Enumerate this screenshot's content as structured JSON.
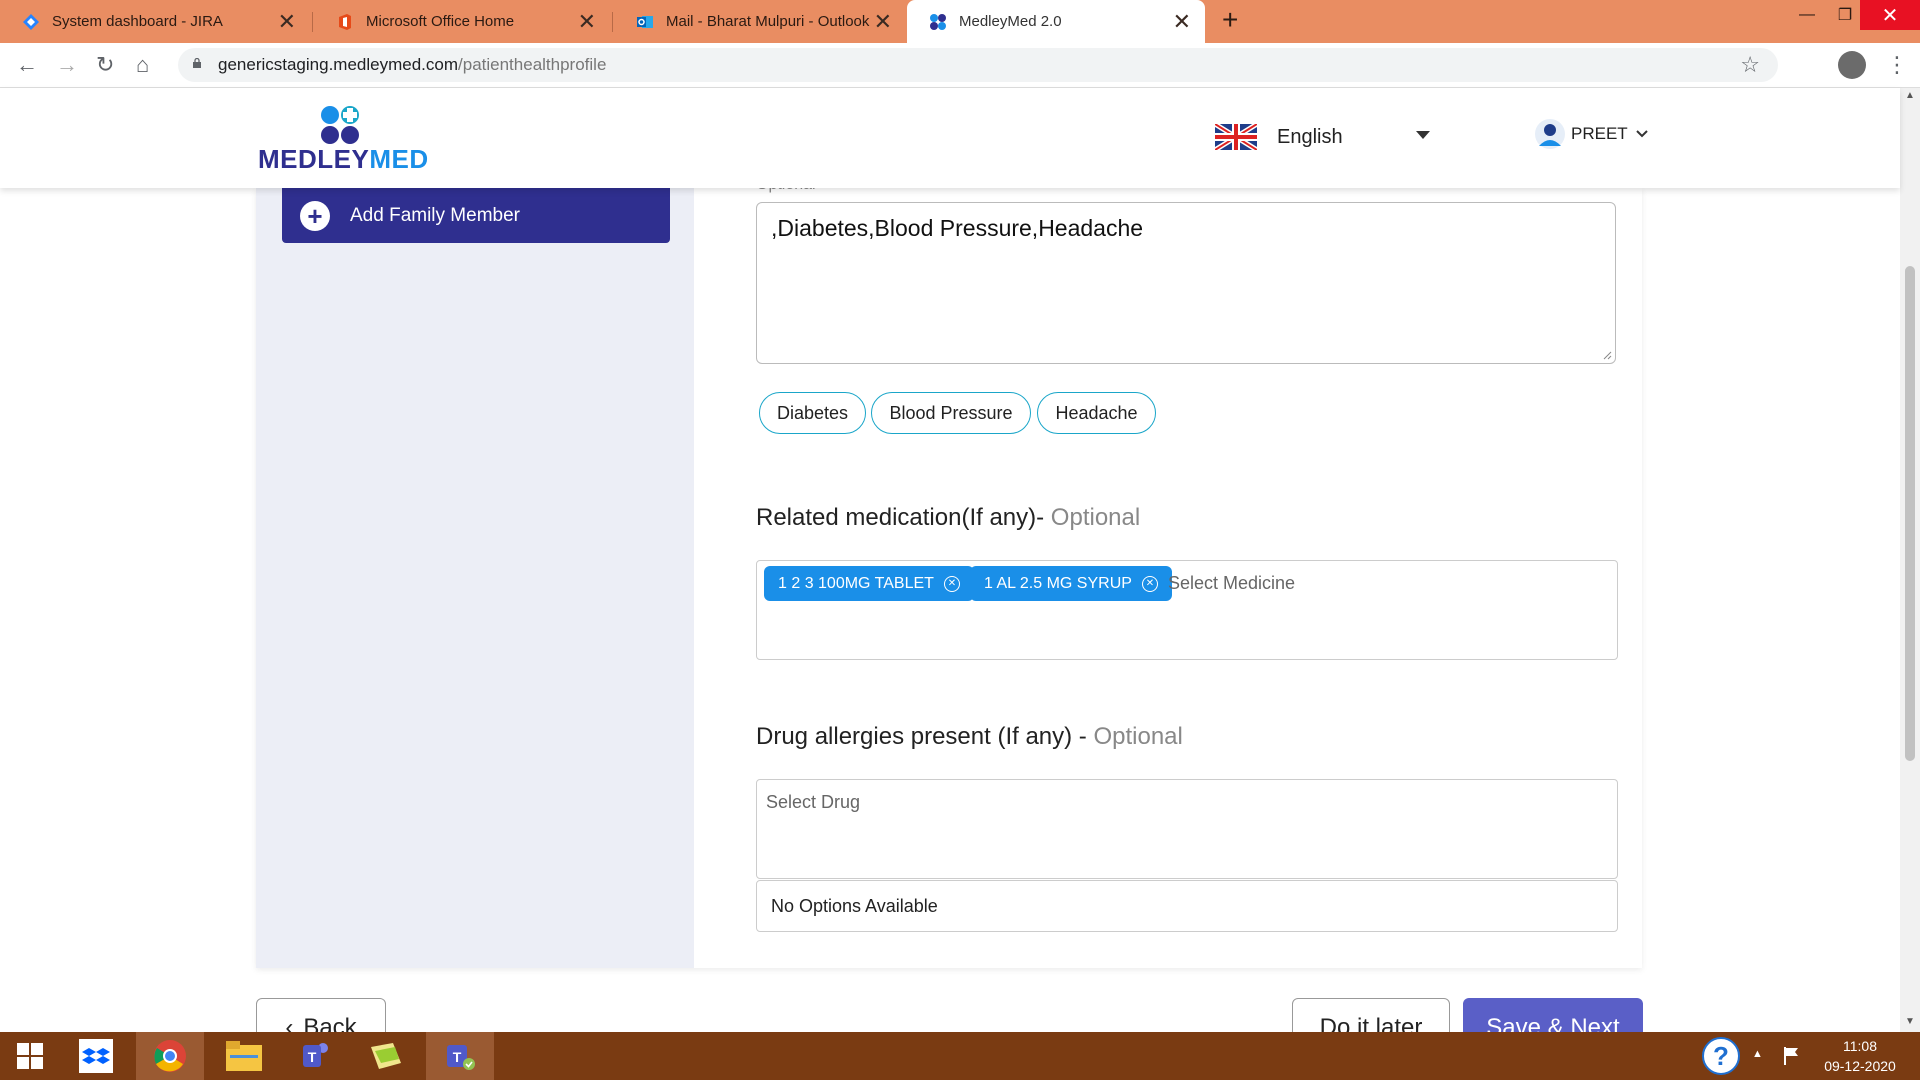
{
  "browser": {
    "tabs": [
      {
        "title": "System dashboard - JIRA",
        "icon": "jira-icon",
        "active": false
      },
      {
        "title": "Microsoft Office Home",
        "icon": "office-icon",
        "active": false
      },
      {
        "title": "Mail - Bharat Mulpuri - Outlook",
        "icon": "outlook-icon",
        "active": false
      },
      {
        "title": "MedleyMed 2.0",
        "icon": "medleymed-icon",
        "active": true
      }
    ],
    "new_tab": "+",
    "close_glyph": "✕",
    "url_domain": "genericstaging.medleymed.com",
    "url_path": "/patienthealthprofile"
  },
  "header": {
    "logo_text_part1": "MEDLEY",
    "logo_text_part2": "MED",
    "language": "English",
    "user_name": "PREET"
  },
  "sidebar": {
    "add_family_label": "Add Family Member"
  },
  "form": {
    "optional_label": "Optional",
    "conditions_text": ",Diabetes,Blood Pressure,Headache",
    "condition_chips": [
      "Diabetes",
      "Blood Pressure",
      "Headache"
    ],
    "medication_title": "Related medication(If any)- ",
    "medication_optional": "Optional",
    "medication_tags": [
      "1 2 3 100MG TABLET",
      "1 AL 2.5 MG SYRUP"
    ],
    "medicine_placeholder": "Select Medicine",
    "allergy_title": "Drug allergies present (If any) - ",
    "allergy_optional": "Optional",
    "drug_placeholder": "Select Drug",
    "no_options": "No Options Available"
  },
  "buttons": {
    "back": "Back",
    "do_it_later": "Do it later",
    "save_next": "Save & Next"
  },
  "taskbar": {
    "time": "11:08",
    "date": "09-12-2020",
    "help": "?"
  },
  "colors": {
    "tabbar": "#e98d62",
    "primary_navy": "#2f2f8f",
    "chip_border": "#1aa6c9",
    "tag_blue": "#1a8fe8",
    "save_button": "#5a5fc7",
    "taskbar": "#7a3b12"
  }
}
